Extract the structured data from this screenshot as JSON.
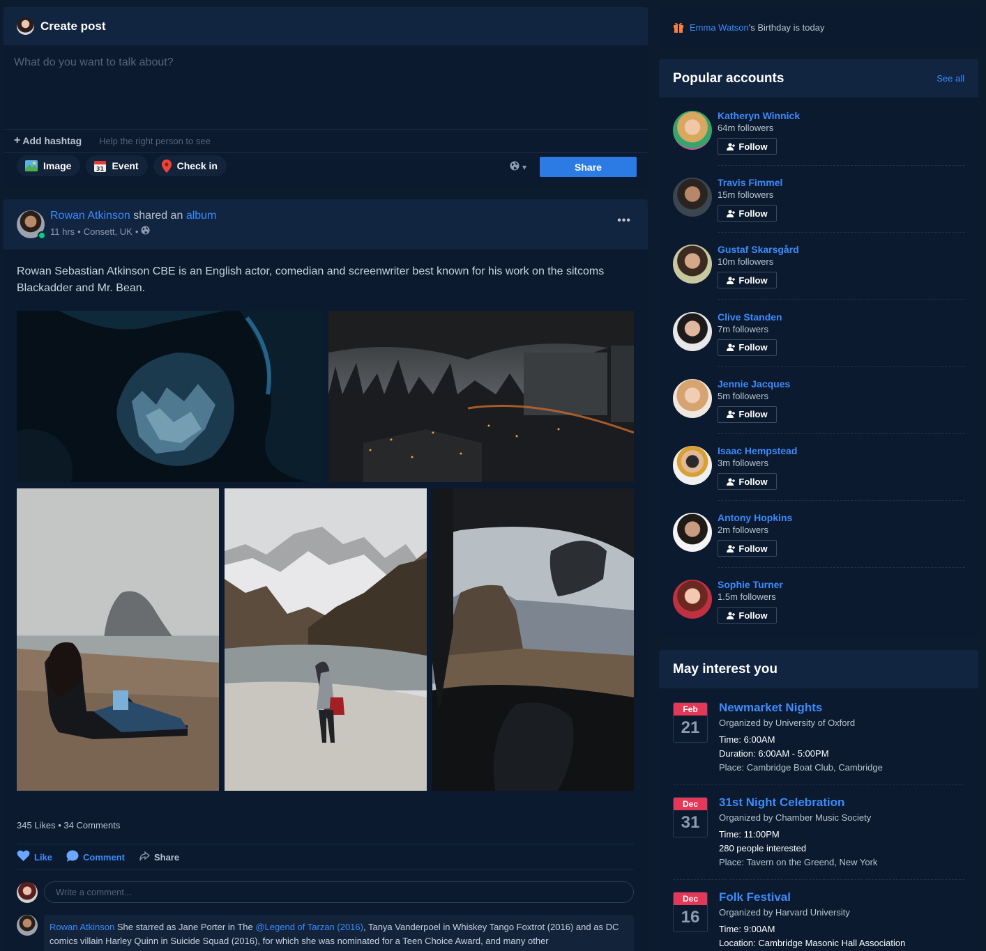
{
  "create_post": {
    "title": "Create post",
    "placeholder": "What do you want to talk about?",
    "add_hashtag": "Add hashtag",
    "hashtag_hint": "Help the right person to see",
    "actions": [
      "Image",
      "Event",
      "Check in"
    ],
    "share_label": "Share"
  },
  "post": {
    "author": "Rowan Atkinson",
    "shared_text": "shared an",
    "shared_object": "album",
    "time": "11 hrs",
    "location": "Consett, UK",
    "text": "Rowan Sebastian Atkinson CBE is an English actor, comedian and screenwriter best known for his work on the sitcoms Blackadder and Mr. Bean.",
    "stats": "345 Likes • 34 Comments",
    "actions": {
      "like": "Like",
      "comment": "Comment",
      "share": "Share"
    },
    "comment_placeholder": "Write a comment...",
    "reply": {
      "author": "Rowan Atkinson",
      "text_before": "She starred as Jane Porter in The",
      "mention": "@Legend of Tarzan (2016)",
      "text_after": ", Tanya Vanderpoel in Whiskey Tango Foxtrot (2016) and as DC comics villain Harley Quinn in Suicide Squad (2016), for which she was nominated for a Teen Choice Award, and many other"
    }
  },
  "birthday": {
    "name": "Emma Watson",
    "suffix": "'s Birthday is today"
  },
  "popular": {
    "title": "Popular accounts",
    "see_all": "See all",
    "follow_label": "Follow",
    "accounts": [
      {
        "name": "Katheryn Winnick",
        "followers": "64m followers"
      },
      {
        "name": "Travis Fimmel",
        "followers": "15m followers"
      },
      {
        "name": "Gustaf Skarsgård",
        "followers": "10m followers"
      },
      {
        "name": "Clive Standen",
        "followers": "7m followers"
      },
      {
        "name": "Jennie Jacques",
        "followers": "5m followers"
      },
      {
        "name": "Isaac Hempstead",
        "followers": "3m followers"
      },
      {
        "name": "Antony Hopkins",
        "followers": "2m followers"
      },
      {
        "name": "Sophie Turner",
        "followers": "1.5m followers"
      }
    ]
  },
  "interest": {
    "title": "May interest you",
    "events": [
      {
        "month": "Feb",
        "day": "21",
        "title": "Newmarket Nights",
        "org": "Organized by University of Oxford",
        "lines": [
          "Time: 6:00AM",
          "Duration: 6:00AM - 5:00PM",
          "Place: Cambridge Boat Club, Cambridge"
        ]
      },
      {
        "month": "Dec",
        "day": "31",
        "title": "31st Night Celebration",
        "org": "Organized by Chamber Music Society",
        "lines": [
          "Time: 11:00PM",
          "280 people interested",
          "Place: Tavern on the Greend, New York"
        ]
      },
      {
        "month": "Dec",
        "day": "16",
        "title": "Folk Festival",
        "org": "Organized by Harvard University",
        "lines": [
          "Time: 9:00AM",
          "Location: Cambridge Masonic Hall Association"
        ]
      }
    ]
  }
}
